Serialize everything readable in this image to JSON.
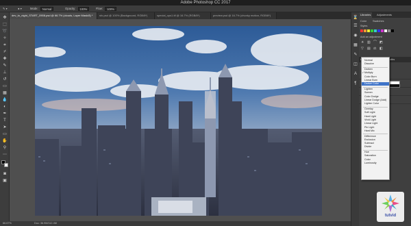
{
  "app": {
    "title": "Adobe Photoshop CC 2017"
  },
  "options": {
    "mode_label": "Mode:",
    "mode_value": "Normal",
    "opacity_label": "Opacity:",
    "opacity_value": "100%",
    "flow_label": "Flow:",
    "flow_value": "100%"
  },
  "tabs": [
    {
      "label": "dev_to_night_START_0908.psd @ 66.7% (clouds, Layer Mask/8) *"
    },
    {
      "label": "sfo.psd @ 100% (Background, RGB/8*)"
    },
    {
      "label": "special_ops1.tif @ 16.7% (RGB/8*)"
    },
    {
      "label": "preview.psd @ 16.7% (chunky motion, RGB/8*)"
    }
  ],
  "status": {
    "zoom": "66.67%",
    "doc": "Doc: 36.9M/112.4M"
  },
  "panels": {
    "tabs": [
      "Libraries",
      "Adjustments"
    ],
    "color_label": "Color",
    "swatches_label": "Swatches",
    "styles_label": "Styles",
    "add_adjustment": "Add an adjustment",
    "lower_tabs": [
      "Layers",
      "Channels",
      "Paths"
    ]
  },
  "blend_modes": {
    "selected": "Darker Color",
    "groups": [
      [
        "Normal",
        "Dissolve"
      ],
      [
        "Darken",
        "Multiply",
        "Color Burn",
        "Linear Burn",
        "Darker Color"
      ],
      [
        "Lighten",
        "Screen",
        "Color Dodge",
        "Linear Dodge (Add)",
        "Lighter Color"
      ],
      [
        "Overlay",
        "Soft Light",
        "Hard Light",
        "Vivid Light",
        "Linear Light",
        "Pin Light",
        "Hard Mix"
      ],
      [
        "Difference",
        "Exclusion",
        "Subtract",
        "Divide"
      ],
      [
        "Hue",
        "Saturation",
        "Color",
        "Luminosity"
      ]
    ]
  },
  "watermark": {
    "text": "tutvid"
  },
  "colors": {
    "accent": "#3f74c9",
    "sky_top": "#2f5f9c",
    "sky_dusk": "#d9a08f"
  }
}
